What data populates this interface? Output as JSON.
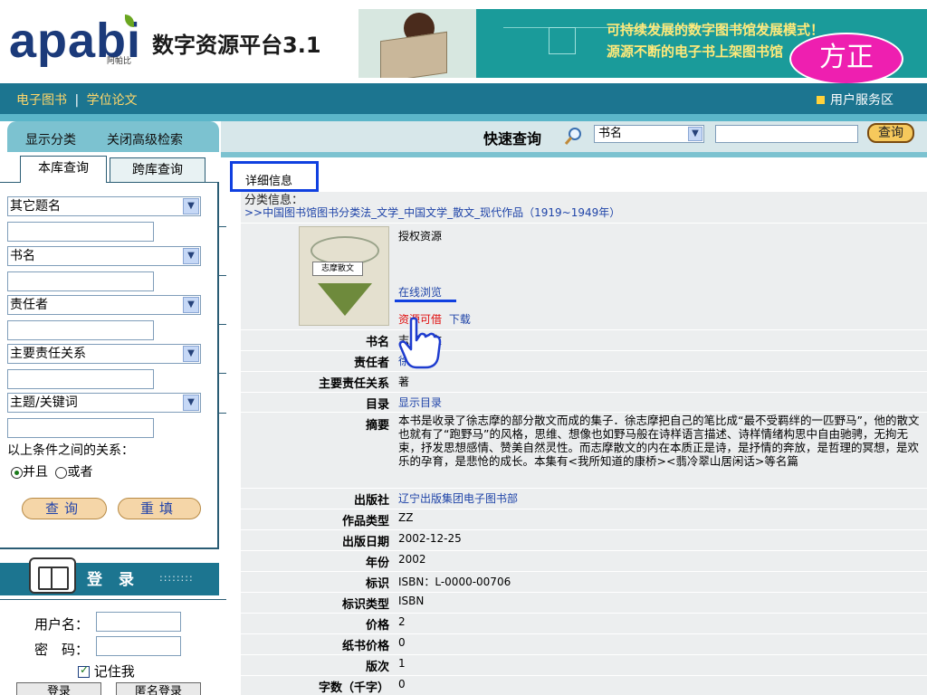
{
  "header": {
    "logo_text": "apabi",
    "logo_sub": "阿帕比",
    "system_title": "数字资源平台3.1",
    "banner_line1": "可持续发展的数字图书馆发展模式！",
    "banner_line2": "源源不断的电子书上架图书馆",
    "founder_badge": "方正"
  },
  "nav": {
    "ebooks": "电子图书",
    "separator": "|",
    "theses": "学位论文",
    "user_service": "用户服务区"
  },
  "sidebar": {
    "show_category": "显示分类",
    "close_advanced": "关闭高级检索",
    "tab_local": "本库查询",
    "tab_cross": "跨库查询",
    "fields": [
      {
        "select": "其它题名"
      },
      {
        "select": "书名"
      },
      {
        "select": "责任者"
      },
      {
        "select": "主要责任关系"
      },
      {
        "select": "主题/关键词"
      }
    ],
    "relation_label": "以上条件之间的关系：",
    "radio_and": "并且",
    "radio_or": "或者",
    "search_btn": "查询",
    "reset_btn": "重填",
    "login_title": "登录",
    "login_dots": "::::::::",
    "username_label": "用户名：",
    "password_label": "密　码：",
    "remember_label": "记住我",
    "login_btn": "登录",
    "anon_btn": "匿名登录"
  },
  "search": {
    "label": "快速查询",
    "field_value": "书名",
    "keyword": "",
    "button": "查询"
  },
  "detail": {
    "tab": "详细信息",
    "class_label": "分类信息：",
    "class_path": ">>中国图书馆图书分类法_文学_中国文学_散文_现代作品（1919~1949年）",
    "cover_label": "志摩散文",
    "auth_resource": "授权资源",
    "online_browse": "在线浏览",
    "available": "资源可借",
    "download": "下载",
    "rows": [
      {
        "key": "书名",
        "value": "志摩散文",
        "link": false
      },
      {
        "key": "责任者",
        "value": "徐志摩",
        "link": true
      },
      {
        "key": "主要责任关系",
        "value": "著",
        "link": false
      },
      {
        "key": "目录",
        "value": "显示目录",
        "link": true
      }
    ],
    "abstract_key": "摘要",
    "abstract": "本书是收录了徐志摩的部分散文而成的集子．徐志摩把自己的笔比成“最不受羁绊的一匹野马”，他的散文也就有了“跑野马”的风格，思维、想像也如野马般在诗样语言描述、诗样情绪构思中自由驰骋，无拘无束，抒发思想感情、赞美自然灵性。而志摩散文的内在本质正是诗，是抒情的奔放，是哲理的冥想，是欢乐的孕育，是悲怆的成长。本集有<我所知道的康桥><翡冷翠山居闲话>等名篇",
    "rows2": [
      {
        "key": "出版社",
        "value": "辽宁出版集团电子图书部",
        "link": true
      },
      {
        "key": "作品类型",
        "value": "ZZ",
        "link": false
      },
      {
        "key": "出版日期",
        "value": "2002-12-25",
        "link": false
      },
      {
        "key": "年份",
        "value": "2002",
        "link": false
      },
      {
        "key": "标识",
        "value": "ISBN：L-0000-00706",
        "link": false
      },
      {
        "key": "标识类型",
        "value": "ISBN",
        "link": false
      },
      {
        "key": "价格",
        "value": "2",
        "link": false
      },
      {
        "key": "纸书价格",
        "value": "0",
        "link": false
      },
      {
        "key": "版次",
        "value": "1",
        "link": false
      },
      {
        "key": "字数（千字）",
        "value": "0",
        "link": false
      }
    ]
  },
  "colors": {
    "nav_bg": "#1c7590",
    "nav_text": "#ffd76a",
    "link": "#1f44a8",
    "available": "#e01010",
    "highlight_box": "#1040e0",
    "founder_badge": "#ee1fb0"
  }
}
